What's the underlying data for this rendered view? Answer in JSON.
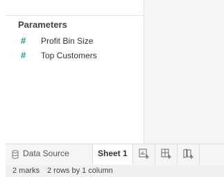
{
  "data_pane": {
    "parameters_header": "Parameters",
    "parameters": [
      {
        "icon": "hash-icon",
        "label": "Profit Bin Size"
      },
      {
        "icon": "hash-icon",
        "label": "Top Customers"
      }
    ]
  },
  "tabs": {
    "data_source_label": "Data Source",
    "sheet_label": "Sheet 1",
    "new_worksheet_icon": "new-worksheet-icon",
    "new_dashboard_icon": "new-dashboard-icon",
    "new_story_icon": "new-story-icon"
  },
  "status_bar": {
    "marks": "2 marks",
    "rows_cols": "2 rows by 1 column"
  },
  "colors": {
    "param_icon": "#1a9a8f",
    "panel_bg": "#f5f5f5"
  }
}
